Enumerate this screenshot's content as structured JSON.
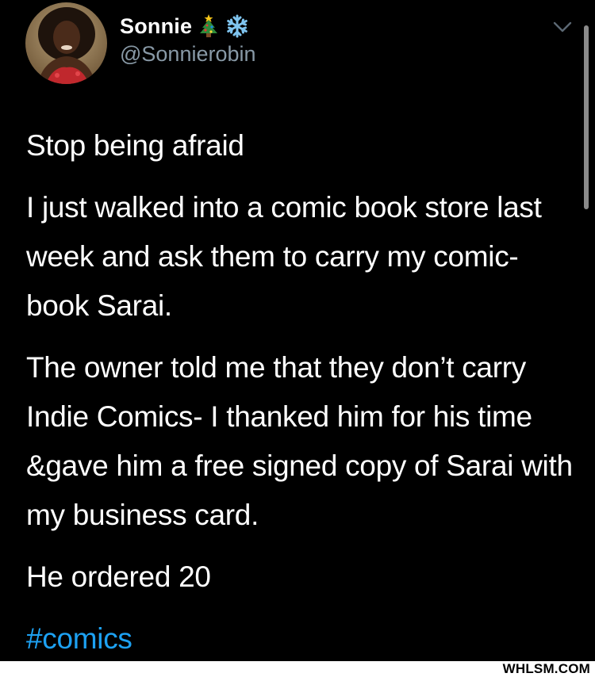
{
  "tweet": {
    "display_name": "Sonnie",
    "name_emojis": [
      "christmas-tree-icon",
      "snowflake-icon"
    ],
    "handle": "@Sonnierobin",
    "paragraphs": [
      "Stop being afraid",
      "I just walked into a comic book store last week and ask them to carry my comic-book Sarai.",
      "The owner told me that they don’t carry Indie Comics- I thanked him for his time &gave him a free signed copy of Sarai with my business card.",
      "He ordered 20"
    ],
    "hashtag": "#comics"
  },
  "colors": {
    "background": "#000000",
    "text": "#ffffff",
    "handle": "#8899a6",
    "hashtag": "#1da1f2",
    "footer": "#ffffff"
  },
  "watermark": "WHLSM.COM"
}
